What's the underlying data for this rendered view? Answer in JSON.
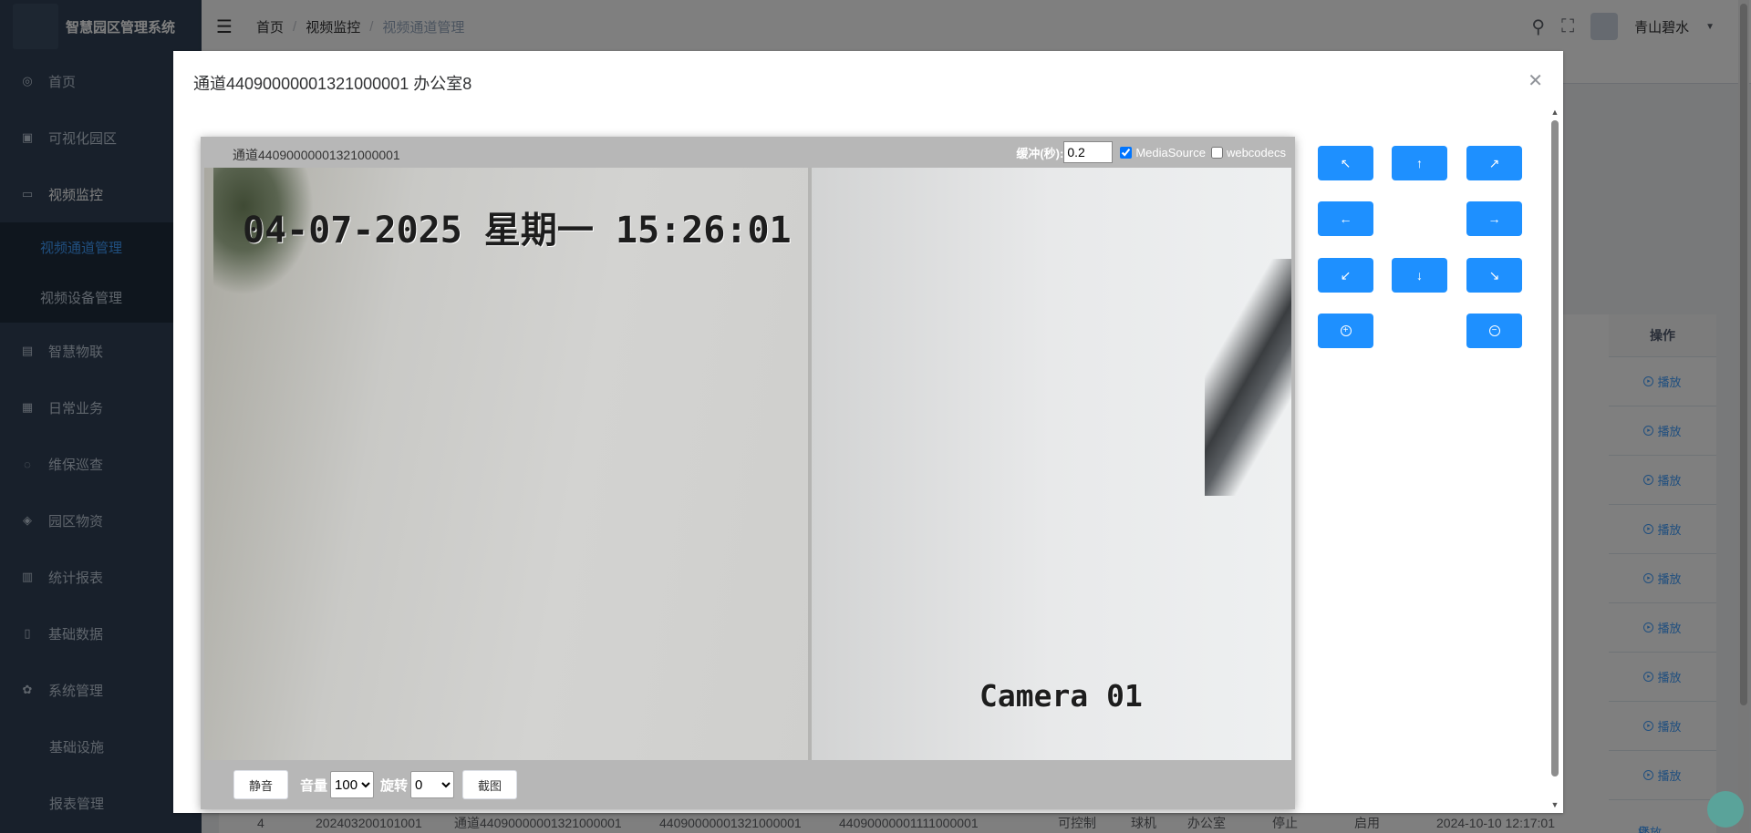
{
  "app": {
    "title": "智慧园区管理系统"
  },
  "sidebar": {
    "items": [
      {
        "label": "首页",
        "icon": "dashboard-icon"
      },
      {
        "label": "可视化园区",
        "icon": "monitor-icon"
      },
      {
        "label": "视频监控",
        "icon": "video-icon",
        "active": true
      },
      {
        "label": "智慧物联",
        "icon": "iot-icon"
      },
      {
        "label": "日常业务",
        "icon": "table-icon"
      },
      {
        "label": "维保巡查",
        "icon": "inspection-icon"
      },
      {
        "label": "园区物资",
        "icon": "box-icon"
      },
      {
        "label": "统计报表",
        "icon": "chart-icon"
      },
      {
        "label": "基础数据",
        "icon": "book-icon"
      },
      {
        "label": "系统管理",
        "icon": "gear-icon"
      }
    ],
    "video_submenu": [
      {
        "label": "视频通道管理",
        "selected": true
      },
      {
        "label": "视频设备管理"
      }
    ],
    "system_submenu": [
      {
        "label": "基础设施"
      },
      {
        "label": "报表管理"
      }
    ]
  },
  "navbar": {
    "breadcrumb": [
      "首页",
      "视频监控",
      "视频通道管理"
    ],
    "user_name": "青山碧水"
  },
  "table": {
    "op_header": "操作",
    "row_action": "播放",
    "row_count_visible": 9,
    "last_row": {
      "index": "4",
      "code": "202403200101001",
      "channel_name": "通道44090000001321000001",
      "channel_id": "44090000001321000001",
      "device_id": "44090000001111000001",
      "ptz": "可控制",
      "type": "球机",
      "location": "办公室",
      "status": "停止",
      "enabled": "启用",
      "time": "2024-10-10 12:17:01"
    }
  },
  "dialog": {
    "title": "通道44090000001321000001 办公室8",
    "close_icon": "close-icon"
  },
  "player": {
    "channel_label": "通道44090000001321000001",
    "buffer_label": "缓冲(秒):",
    "buffer_value": "0.2",
    "mediasource_label": "MediaSource",
    "mediasource_checked": true,
    "webcodecs_label": "webcodecs",
    "webcodecs_checked": false,
    "osd_time": "04-07-2025 星期一 15:26:01",
    "osd_camera": "Camera 01",
    "mute_label": "静音",
    "volume_label": "音量",
    "volume_value": "100",
    "rotate_label": "旋转",
    "rotate_value": "0",
    "snapshot_label": "截图"
  },
  "ptz": {
    "up_left": "arrow-up-left-icon",
    "up": "arrow-up-icon",
    "up_right": "arrow-up-right-icon",
    "left": "arrow-left-icon",
    "right": "arrow-right-icon",
    "down_left": "arrow-down-left-icon",
    "down": "arrow-down-icon",
    "down_right": "arrow-down-right-icon",
    "zoom_in": "zoom-in-icon",
    "zoom_out": "zoom-out-icon"
  },
  "colors": {
    "sidebar_bg": "#304156",
    "submenu_bg": "#1f2d3d",
    "accent": "#409eff",
    "ptz_button": "#1e90ff"
  }
}
